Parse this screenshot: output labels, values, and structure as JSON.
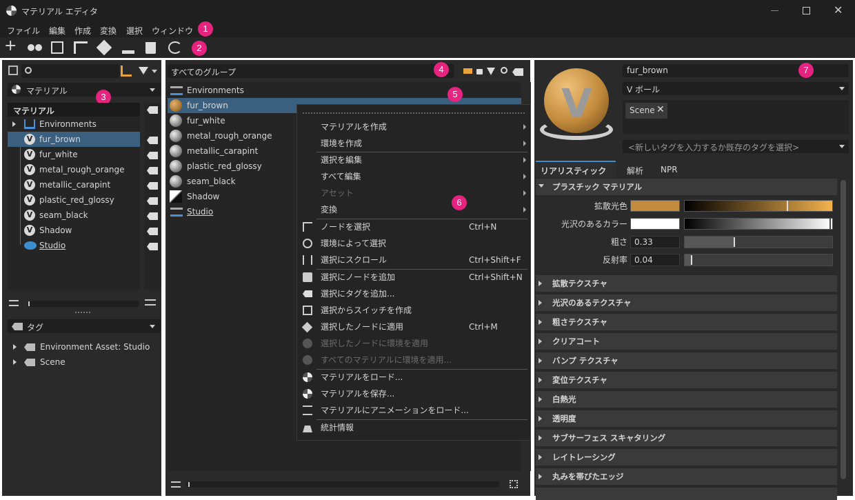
{
  "window": {
    "title": "マテリアル エディタ"
  },
  "menu": [
    "ファイル",
    "編集",
    "作成",
    "変換",
    "選択",
    "ウィンドウ"
  ],
  "markers": [
    "1",
    "2",
    "3",
    "4",
    "5",
    "6",
    "7"
  ],
  "colors": {
    "accent": "#e6237e",
    "selection": "#3b5f7f",
    "fur_brown": "#c28a3c"
  },
  "left_panel": {
    "dropdown": "マテリアル",
    "tree_header": "マテリアル",
    "items": [
      "Environments",
      "fur_brown",
      "fur_white",
      "metal_rough_orange",
      "metallic_carapint",
      "plastic_red_glossy",
      "seam_black",
      "Shadow",
      "Studio"
    ],
    "tag_dropdown": "タグ",
    "tags": [
      "Environment Asset: Studio",
      "Scene"
    ]
  },
  "middle_panel": {
    "group_dropdown": "すべてのグループ",
    "items": [
      "Environments",
      "fur_brown",
      "fur_white",
      "metal_rough_orange",
      "metallic_carapint",
      "plastic_red_glossy",
      "seam_black",
      "Shadow",
      "Studio"
    ]
  },
  "context_menu": {
    "items": [
      {
        "label": "マテリアルを作成",
        "shortcut": ""
      },
      {
        "label": "環境を作成",
        "shortcut": ""
      },
      {
        "label": "選択を編集",
        "shortcut": ""
      },
      {
        "label": "すべて編集",
        "shortcut": ""
      },
      {
        "label": "アセット",
        "shortcut": ""
      },
      {
        "label": "変換",
        "shortcut": ""
      },
      {
        "label": "ノードを選択",
        "shortcut": "Ctrl+N"
      },
      {
        "label": "環境によって選択",
        "shortcut": ""
      },
      {
        "label": "選択にスクロール",
        "shortcut": "Ctrl+Shift+F"
      },
      {
        "label": "選択にノードを追加",
        "shortcut": "Ctrl+Shift+N"
      },
      {
        "label": "選択にタグを追加...",
        "shortcut": ""
      },
      {
        "label": "選択からスイッチを作成",
        "shortcut": ""
      },
      {
        "label": "選択したノードに適用",
        "shortcut": "Ctrl+M"
      },
      {
        "label": "選択したノードに環境を適用",
        "shortcut": ""
      },
      {
        "label": "すべてのマテリアルに環境を適用...",
        "shortcut": ""
      },
      {
        "label": "マテリアルをロード...",
        "shortcut": ""
      },
      {
        "label": "マテリアルを保存...",
        "shortcut": ""
      },
      {
        "label": "マテリアルにアニメーションをロード...",
        "shortcut": ""
      },
      {
        "label": "統計情報",
        "shortcut": ""
      }
    ]
  },
  "right_panel": {
    "name": "fur_brown",
    "preview_shape": "V ボール",
    "tag": "Scene",
    "tag_placeholder": "<新しいタグを入力するか既存のタグを選択>",
    "tabs": [
      "リアリスティック",
      "解析",
      "NPR"
    ],
    "main_section": "プラスチック マテリアル",
    "props": {
      "diffuse_label": "拡散光色",
      "gloss_label": "光沢のあるカラー",
      "roughness_label": "粗さ",
      "roughness_value": "0.33",
      "roughness_fraction": 0.33,
      "reflectivity_label": "反射率",
      "reflectivity_value": "0.04",
      "reflectivity_fraction": 0.04
    },
    "sections": [
      "拡散テクスチャ",
      "光沢のあるテクスチャ",
      "粗さテクスチャ",
      "クリアコート",
      "バンプ テクスチャ",
      "変位テクスチャ",
      "白熱光",
      "透明度",
      "サブサーフェス スキャタリング",
      "レイトレーシング",
      "丸みを帯びたエッジ"
    ]
  }
}
